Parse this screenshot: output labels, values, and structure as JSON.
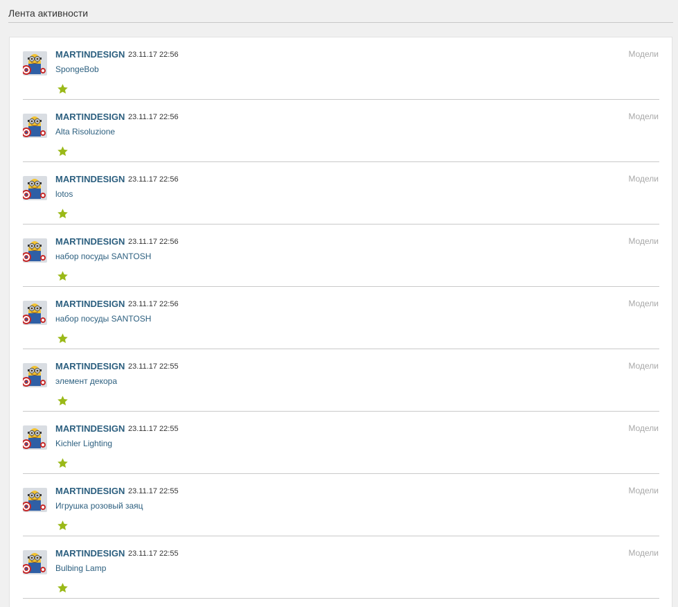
{
  "header": {
    "title": "Лента активности"
  },
  "colors": {
    "link": "#2c5f7f",
    "star": "#9ab918",
    "category": "#a8a8a8"
  },
  "feed": {
    "items": [
      {
        "user": "MARTINDESIGN",
        "time": "23.11.17 22:56",
        "title": "SpongeBob",
        "category": "Модели",
        "icon": "star-icon"
      },
      {
        "user": "MARTINDESIGN",
        "time": "23.11.17 22:56",
        "title": "Alta Risoluzione",
        "category": "Модели",
        "icon": "star-icon"
      },
      {
        "user": "MARTINDESIGN",
        "time": "23.11.17 22:56",
        "title": "lotos",
        "category": "Модели",
        "icon": "star-icon"
      },
      {
        "user": "MARTINDESIGN",
        "time": "23.11.17 22:56",
        "title": "набор посуды SANTOSH",
        "category": "Модели",
        "icon": "star-icon"
      },
      {
        "user": "MARTINDESIGN",
        "time": "23.11.17 22:56",
        "title": "набор посуды SANTOSH",
        "category": "Модели",
        "icon": "star-icon"
      },
      {
        "user": "MARTINDESIGN",
        "time": "23.11.17 22:55",
        "title": "элемент декора",
        "category": "Модели",
        "icon": "star-icon"
      },
      {
        "user": "MARTINDESIGN",
        "time": "23.11.17 22:55",
        "title": "Kichler Lighting",
        "category": "Модели",
        "icon": "star-icon"
      },
      {
        "user": "MARTINDESIGN",
        "time": "23.11.17 22:55",
        "title": "Игрушка розовый заяц",
        "category": "Модели",
        "icon": "star-icon"
      },
      {
        "user": "MARTINDESIGN",
        "time": "23.11.17 22:55",
        "title": "Bulbing Lamp",
        "category": "Модели",
        "icon": "star-icon"
      }
    ]
  }
}
